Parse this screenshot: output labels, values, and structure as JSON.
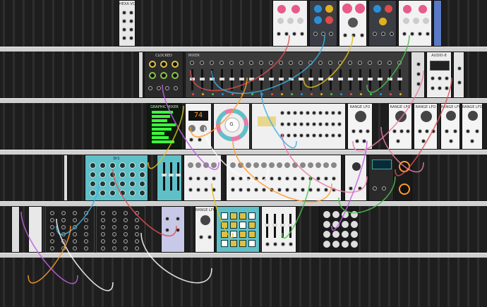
{
  "modules": {
    "top_small_title": "HEXA VCA",
    "clocked": "CLOCKED",
    "audio": "AUDIO-8",
    "scope": "GRAPHIC MIXER",
    "range_lfo_1": "RANGE LFO",
    "range_lfo_2": "RANGE LFO",
    "range_lfo_3": "RANGE LFO",
    "range_lfo_4": "RANGE LFO",
    "range_lfo_5": "RANGE LFO",
    "range_lfo_6": "RANGE LFO",
    "segment_display": "74",
    "chord_disp": "G",
    "drum_title": "Dr1",
    "mixer_title": "MIXER"
  },
  "colors": {
    "rail": "#cfcfcf",
    "row_bg": "#1e1e1e",
    "teal": "#5fc0c8",
    "pink": "#e8a0b8",
    "green_led": "#3cff3c",
    "orange_screen": "#ff9a2a"
  }
}
